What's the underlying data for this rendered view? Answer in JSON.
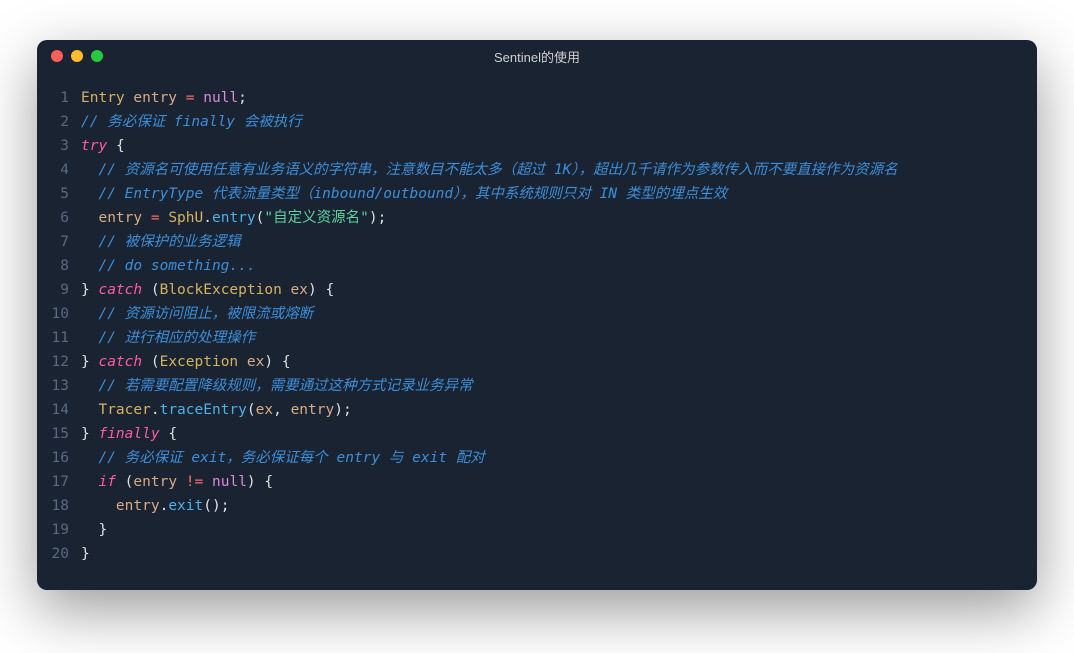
{
  "window": {
    "title": "Sentinel的使用"
  },
  "code": {
    "lines": [
      {
        "n": 1,
        "tokens": [
          [
            "type",
            "Entry"
          ],
          [
            "plain",
            " "
          ],
          [
            "var",
            "entry"
          ],
          [
            "plain",
            " "
          ],
          [
            "op",
            "="
          ],
          [
            "plain",
            " "
          ],
          [
            "null",
            "null"
          ],
          [
            "punct",
            ";"
          ]
        ]
      },
      {
        "n": 2,
        "tokens": [
          [
            "comment",
            "// 务必保证 finally 会被执行"
          ]
        ]
      },
      {
        "n": 3,
        "tokens": [
          [
            "keyword",
            "try"
          ],
          [
            "plain",
            " "
          ],
          [
            "punct",
            "{"
          ]
        ]
      },
      {
        "n": 4,
        "tokens": [
          [
            "plain",
            "  "
          ],
          [
            "comment",
            "// 资源名可使用任意有业务语义的字符串，注意数目不能太多（超过 1K），超出几千请作为参数传入而不要直接作为资源名"
          ]
        ]
      },
      {
        "n": 5,
        "tokens": [
          [
            "plain",
            "  "
          ],
          [
            "comment",
            "// EntryType 代表流量类型（inbound/outbound），其中系统规则只对 IN 类型的埋点生效"
          ]
        ]
      },
      {
        "n": 6,
        "tokens": [
          [
            "plain",
            "  "
          ],
          [
            "var",
            "entry"
          ],
          [
            "plain",
            " "
          ],
          [
            "op",
            "="
          ],
          [
            "plain",
            " "
          ],
          [
            "class",
            "SphU"
          ],
          [
            "punct",
            "."
          ],
          [
            "method",
            "entry"
          ],
          [
            "punct",
            "("
          ],
          [
            "string",
            "\"自定义资源名\""
          ],
          [
            "punct",
            ")"
          ],
          [
            "punct",
            ";"
          ]
        ]
      },
      {
        "n": 7,
        "tokens": [
          [
            "plain",
            "  "
          ],
          [
            "comment",
            "// 被保护的业务逻辑"
          ]
        ]
      },
      {
        "n": 8,
        "tokens": [
          [
            "plain",
            "  "
          ],
          [
            "comment",
            "// do something..."
          ]
        ]
      },
      {
        "n": 9,
        "tokens": [
          [
            "punct",
            "}"
          ],
          [
            "plain",
            " "
          ],
          [
            "keyword",
            "catch"
          ],
          [
            "plain",
            " "
          ],
          [
            "punct",
            "("
          ],
          [
            "type",
            "BlockException"
          ],
          [
            "plain",
            " "
          ],
          [
            "param",
            "ex"
          ],
          [
            "punct",
            ")"
          ],
          [
            "plain",
            " "
          ],
          [
            "punct",
            "{"
          ]
        ]
      },
      {
        "n": 10,
        "tokens": [
          [
            "plain",
            "  "
          ],
          [
            "comment",
            "// 资源访问阻止，被限流或熔断"
          ]
        ]
      },
      {
        "n": 11,
        "tokens": [
          [
            "plain",
            "  "
          ],
          [
            "comment",
            "// 进行相应的处理操作"
          ]
        ]
      },
      {
        "n": 12,
        "tokens": [
          [
            "punct",
            "}"
          ],
          [
            "plain",
            " "
          ],
          [
            "keyword",
            "catch"
          ],
          [
            "plain",
            " "
          ],
          [
            "punct",
            "("
          ],
          [
            "type",
            "Exception"
          ],
          [
            "plain",
            " "
          ],
          [
            "param",
            "ex"
          ],
          [
            "punct",
            ")"
          ],
          [
            "plain",
            " "
          ],
          [
            "punct",
            "{"
          ]
        ]
      },
      {
        "n": 13,
        "tokens": [
          [
            "plain",
            "  "
          ],
          [
            "comment",
            "// 若需要配置降级规则，需要通过这种方式记录业务异常"
          ]
        ]
      },
      {
        "n": 14,
        "tokens": [
          [
            "plain",
            "  "
          ],
          [
            "class",
            "Tracer"
          ],
          [
            "punct",
            "."
          ],
          [
            "method",
            "traceEntry"
          ],
          [
            "punct",
            "("
          ],
          [
            "param",
            "ex"
          ],
          [
            "punct",
            ","
          ],
          [
            "plain",
            " "
          ],
          [
            "param",
            "entry"
          ],
          [
            "punct",
            ")"
          ],
          [
            "punct",
            ";"
          ]
        ]
      },
      {
        "n": 15,
        "tokens": [
          [
            "punct",
            "}"
          ],
          [
            "plain",
            " "
          ],
          [
            "keyword",
            "finally"
          ],
          [
            "plain",
            " "
          ],
          [
            "punct",
            "{"
          ]
        ]
      },
      {
        "n": 16,
        "tokens": [
          [
            "plain",
            "  "
          ],
          [
            "comment",
            "// 务必保证 exit，务必保证每个 entry 与 exit 配对"
          ]
        ]
      },
      {
        "n": 17,
        "tokens": [
          [
            "plain",
            "  "
          ],
          [
            "keyword",
            "if"
          ],
          [
            "plain",
            " "
          ],
          [
            "punct",
            "("
          ],
          [
            "var",
            "entry"
          ],
          [
            "plain",
            " "
          ],
          [
            "op",
            "!="
          ],
          [
            "plain",
            " "
          ],
          [
            "null",
            "null"
          ],
          [
            "punct",
            ")"
          ],
          [
            "plain",
            " "
          ],
          [
            "punct",
            "{"
          ]
        ]
      },
      {
        "n": 18,
        "tokens": [
          [
            "plain",
            "    "
          ],
          [
            "var",
            "entry"
          ],
          [
            "punct",
            "."
          ],
          [
            "method",
            "exit"
          ],
          [
            "punct",
            "("
          ],
          [
            "punct",
            ")"
          ],
          [
            "punct",
            ";"
          ]
        ]
      },
      {
        "n": 19,
        "tokens": [
          [
            "plain",
            "  "
          ],
          [
            "punct",
            "}"
          ]
        ]
      },
      {
        "n": 20,
        "tokens": [
          [
            "punct",
            "}"
          ]
        ]
      }
    ]
  }
}
